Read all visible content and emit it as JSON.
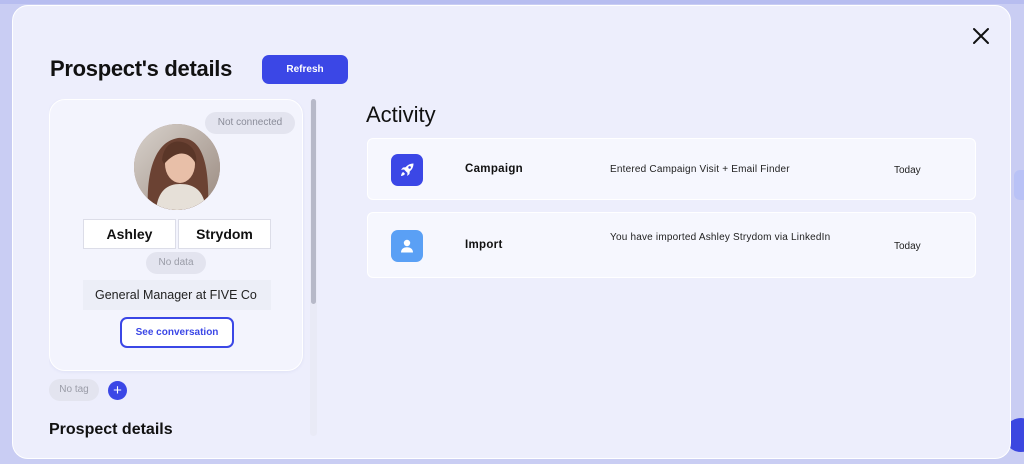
{
  "modal": {
    "title": "Prospect's details",
    "refresh_label": "Refresh",
    "close_icon": "close-icon"
  },
  "profile": {
    "connection_status": "Not connected",
    "first_name": "Ashley",
    "last_name": "Strydom",
    "no_data_label": "No data",
    "job_title": "General Manager at FIVE Co",
    "see_conversation_label": "See conversation",
    "tag_label": "No tag",
    "add_tag_label": "+"
  },
  "prospect_section": {
    "heading": "Prospect details"
  },
  "activity": {
    "title": "Activity",
    "items": [
      {
        "icon": "rocket-icon",
        "type": "Campaign",
        "description": "Entered Campaign Visit + Email Finder",
        "time": "Today",
        "icon_color": "#3b47e6"
      },
      {
        "icon": "user-icon",
        "type": "Import",
        "description": "You have imported Ashley Strydom via LinkedIn",
        "time": "Today",
        "icon_color": "#5aa0f5"
      }
    ]
  },
  "colors": {
    "accent": "#3b47e6",
    "modal_bg": "#edeefc",
    "page_bg": "#c9cdf3"
  }
}
